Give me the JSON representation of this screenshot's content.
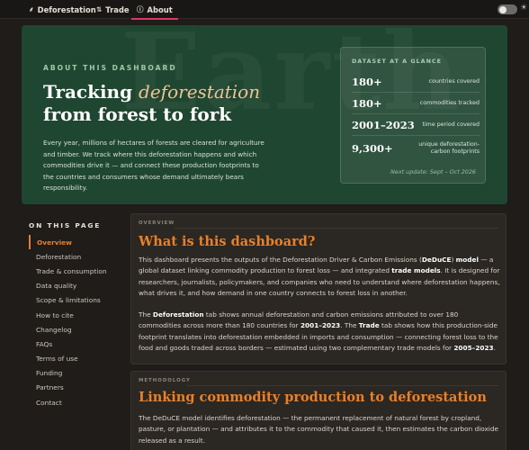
{
  "nav": {
    "tabs": [
      {
        "label": "Deforestation",
        "icon": "leaf-icon",
        "glyph": "⸙"
      },
      {
        "label": "Trade",
        "icon": "trade-arrows-icon",
        "glyph": "⇅"
      },
      {
        "label": "About",
        "icon": "info-icon",
        "glyph": "ⓘ"
      }
    ],
    "active_tab": "About",
    "theme_icon": "☀"
  },
  "hero": {
    "watermark": "Earth",
    "eyebrow": "ABOUT THIS DASHBOARD",
    "title_line1_a": "Tracking ",
    "title_line1_em": "deforestation",
    "title_line2": "from forest to fork",
    "description": "Every year, millions of hectares of forests are cleared for agriculture and timber. We track where this deforestation happens and which commodities drive it — and connect these production footprints to the countries and consumers whose demand ultimately bears responsibility."
  },
  "glance": {
    "title": "DATASET AT A GLANCE",
    "rows": [
      {
        "value": "180+",
        "label": "countries covered"
      },
      {
        "value": "180+",
        "label": "commodities tracked"
      },
      {
        "value": "2001–2023",
        "label": "time period covered"
      },
      {
        "value": "9,300+",
        "label": "unique deforestation-carbon footprints"
      }
    ],
    "next_update": "Next update: Sept – Oct 2026"
  },
  "toc": {
    "title": "ON THIS PAGE",
    "items": [
      "Overview",
      "Deforestation",
      "Trade & consumption",
      "Data quality",
      "Scope & limitations",
      "How to cite",
      "Changelog",
      "FAQs",
      "Terms of use",
      "Funding",
      "Partners",
      "Contact"
    ],
    "active": "Overview"
  },
  "overview": {
    "kicker": "OVERVIEW",
    "title": "What is this dashboard?",
    "p1": [
      {
        "t": "This dashboard presents the outputs of the Deforestation Driver & Carbon Emissions ("
      },
      {
        "t": "DeDuCE",
        "b": true
      },
      {
        "t": ") "
      },
      {
        "t": "model",
        "b": true
      },
      {
        "t": " — a global dataset linking commodity production to forest loss — and integrated "
      },
      {
        "t": "trade models",
        "b": true
      },
      {
        "t": ". It is designed for researchers, journalists, policymakers, and companies who need to understand where deforestation happens, what drives it, and how demand in one country connects to forest loss in another."
      }
    ],
    "p2": [
      {
        "t": "The "
      },
      {
        "t": "Deforestation",
        "b": true
      },
      {
        "t": " tab shows annual deforestation and carbon emissions attributed to over 180 commodities across more than 180 countries for "
      },
      {
        "t": "2001–2023",
        "b": true
      },
      {
        "t": ". The "
      },
      {
        "t": "Trade",
        "b": true
      },
      {
        "t": " tab shows how this production-side footprint translates into deforestation embedded in imports and consumption — connecting forest loss to the food and goods traded across borders — estimated using two complementary trade models for "
      },
      {
        "t": "2005–2023",
        "b": true
      },
      {
        "t": "."
      }
    ]
  },
  "methodology": {
    "kicker": "METHODOLOGY",
    "title": "Linking commodity production to deforestation",
    "p1": "The DeDuCE model identifies deforestation — the permanent replacement of natural forest by cropland, pasture, or plantation — and attributes it to the commodity that caused it, then estimates the carbon dioxide released as a result."
  },
  "colors": {
    "accent": "#e8802a",
    "tab_underline": "#d63a64",
    "hero_bg": "#1f4630",
    "page_bg": "#1f1c1a"
  }
}
